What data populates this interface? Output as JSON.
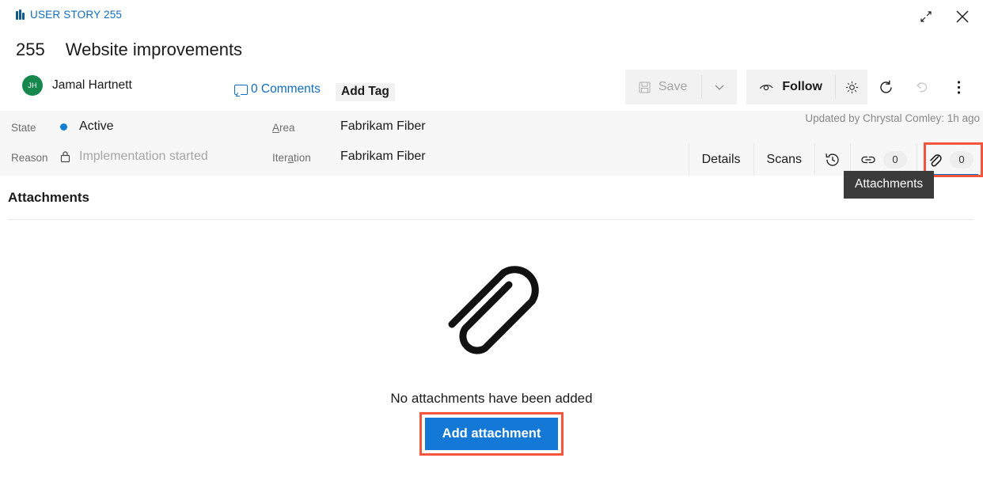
{
  "window": {
    "work_item_type": "USER STORY 255",
    "type_icon": "user-story-icon",
    "restore_icon": "restore-window-icon",
    "close_icon": "close-icon"
  },
  "header": {
    "id": "255",
    "title": "Website improvements",
    "assignee": "Jamal Hartnett",
    "assignee_initials": "JH",
    "comments_label": "0 Comments",
    "comments_icon": "comment-bubble-icon",
    "add_tag_label": "Add Tag"
  },
  "toolbar": {
    "save_label": "Save",
    "save_icon": "save-disk-icon",
    "save_caret_icon": "chevron-down-icon",
    "follow_label": "Follow",
    "follow_icon": "eye-icon",
    "settings_icon": "gear-icon",
    "refresh_icon": "refresh-icon",
    "undo_icon": "undo-icon",
    "more_icon": "more-vertical-icon"
  },
  "fields": {
    "state_label": "State",
    "state_value": "Active",
    "state_color": "#0f7fd4",
    "reason_label": "Reason",
    "reason_value": "Implementation started",
    "reason_icon": "lock-icon",
    "area_label": "Area",
    "area_value": "Fabrikam Fiber",
    "iteration_label": "Iteration",
    "iteration_value": "Fabrikam Fiber",
    "updated_by": "Updated by Chrystal Comley: 1h ago"
  },
  "tabs": {
    "details_label": "Details",
    "scans_label": "Scans",
    "history_icon": "history-icon",
    "links_icon": "link-icon",
    "links_count": "0",
    "attachments_icon": "paperclip-icon",
    "attachments_count": "0",
    "active_tab": "attachments",
    "tooltip": "Attachments",
    "highlight_color": "#f4553d"
  },
  "content": {
    "section_title": "Attachments",
    "empty_icon": "large-paperclip-icon",
    "empty_text": "No attachments have been added",
    "add_attachment_label": "Add attachment",
    "add_attachment_color": "#1479d6"
  }
}
